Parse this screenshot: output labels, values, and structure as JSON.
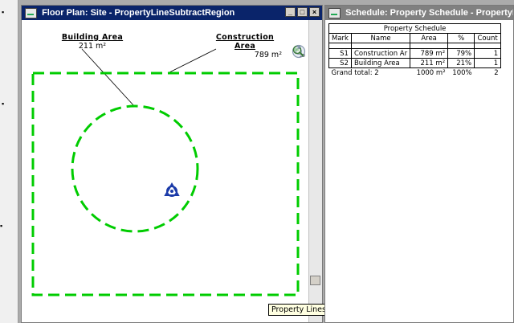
{
  "floorplan": {
    "title": "Floor Plan: Site - PropertyLineSubtractRegion",
    "window_buttons": [
      "_",
      "□",
      "×"
    ],
    "labels": {
      "building_area": {
        "title": "Building Area",
        "value": "211 m²"
      },
      "construction_area": {
        "title": "Construction Area",
        "value": "789 m²"
      }
    },
    "nav_icons": [
      "steering-wheel-icon",
      "zoom-region-icon"
    ],
    "tooltip": "Property Lines : Property",
    "colors": {
      "boundary": "#00cc00",
      "nav_symbol": "#1a3aa8"
    }
  },
  "schedule": {
    "title": "Schedule: Property Schedule - PropertyLineSubtractRegion",
    "table_title": "Property Schedule",
    "columns": [
      "Mark",
      "Name",
      "Area",
      "%",
      "Count"
    ],
    "rows": [
      {
        "mark": "S1",
        "name": "Construction Ar",
        "area": "789 m²",
        "pct": "79%",
        "count": "1"
      },
      {
        "mark": "S2",
        "name": "Building Area",
        "area": "211 m²",
        "pct": "21%",
        "count": "1"
      }
    ],
    "grand_total": {
      "label": "Grand total: 2",
      "area": "1000 m²",
      "pct": "100%",
      "count": "2"
    }
  }
}
